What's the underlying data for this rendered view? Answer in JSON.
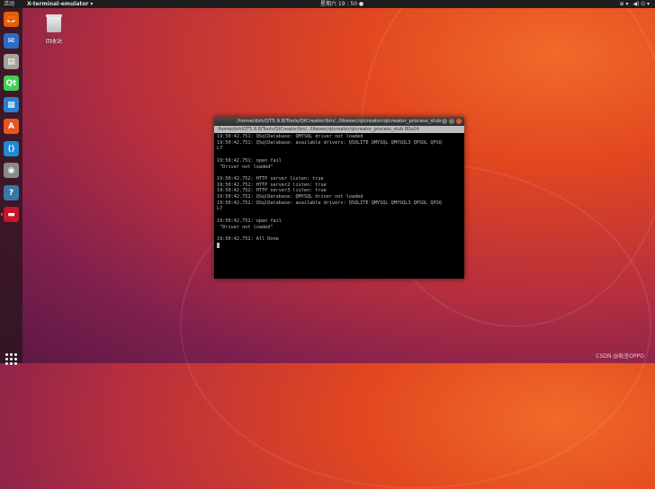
{
  "topbar": {
    "activities": "活动",
    "app_menu": "X-terminal-emulator ▾",
    "clock": "星期六 19 : 50 ●",
    "tray": [
      "⊕ ▾",
      "◀) ⏻ ▾"
    ]
  },
  "desktop": {
    "trash_label": "回收站"
  },
  "dock": {
    "items": [
      {
        "icon": "firefox-icon",
        "color": "#e66000",
        "glyph": "🦊"
      },
      {
        "icon": "thunderbird-icon",
        "color": "#2b6cc4",
        "glyph": "✉"
      },
      {
        "icon": "files-icon",
        "color": "#a8a29b",
        "glyph": "▤"
      },
      {
        "icon": "qtcreator-icon",
        "color": "#41cd52",
        "glyph": "Qt"
      },
      {
        "icon": "libreoffice-writer-icon",
        "color": "#2a7fd4",
        "glyph": "▦"
      },
      {
        "icon": "software-center-icon",
        "color": "#e95420",
        "glyph": "A"
      },
      {
        "icon": "vscode-icon",
        "color": "#1f8ad2",
        "glyph": "⟨⟩"
      },
      {
        "icon": "screenshot-icon",
        "color": "#8a8a8a",
        "glyph": "◉"
      },
      {
        "icon": "help-icon",
        "color": "#3776ab",
        "glyph": "?"
      },
      {
        "icon": "terminal-app-icon",
        "color": "#c7162b",
        "glyph": "▬"
      }
    ]
  },
  "terminal": {
    "title": "/home/dzh/QT5.9.8/Tools/QtCreator/bin/../libexec/qtcreator/qtcreator_process_stub",
    "tab": "/home/dzh/QT5.9.8/Tools/QtCreator/bin/../libexec/qtcreator/qtcreator_process_stub 80x24",
    "lines": [
      "19:50:42.751: QSqlDatabase: QMYSQL driver not loaded",
      "19:50:42.751: QSqlDatabase: available drivers: QSQLITE QMYSQL QMYSQL3 QPSQL QPSQ",
      "L7",
      "",
      "19:50:42.751: open fail",
      " \"Driver not loaded\"",
      "",
      "19:50:42.752: HTTP server listen: true",
      "19:50:42.752: HTTP server2 listen: true",
      "19:50:42.752: HTTP server3 listen: true",
      "19:50:42.752: QSqlDatabase: QMYSQL driver not loaded",
      "19:50:42.752: QSqlDatabase: available drivers: QSQLITE QMYSQL QMYSQL3 QPSQL QPSQ",
      "L7",
      "",
      "19:50:42.752: open fail",
      " \"Driver not loaded\"",
      "",
      "19:50:42.752: All Done"
    ]
  },
  "watermark": "CSDN @坂坐OPPO"
}
